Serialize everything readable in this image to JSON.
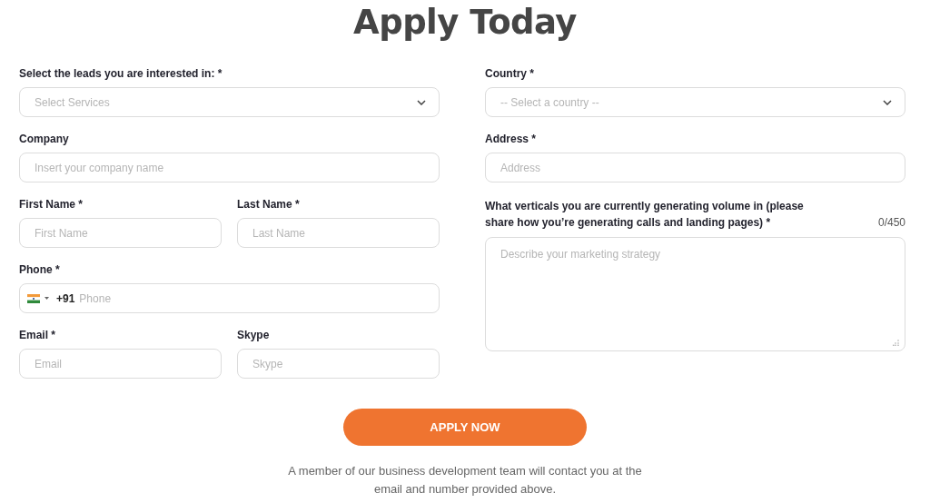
{
  "title": "Apply Today",
  "left_column": [
    {
      "fields": [
        {
          "kind": "select",
          "label": "Select the leads you are interested in: *",
          "placeholder": "Select Services"
        }
      ]
    },
    {
      "fields": [
        {
          "kind": "text",
          "label": "Company",
          "placeholder": "Insert your company name"
        }
      ]
    },
    {
      "fields": [
        {
          "kind": "text",
          "label": "First Name *",
          "placeholder": "First Name"
        },
        {
          "kind": "text",
          "label": "Last Name *",
          "placeholder": "Last Name"
        }
      ]
    },
    {
      "fields": [
        {
          "kind": "phone",
          "label": "Phone *",
          "dial_code": "+91",
          "placeholder": "Phone"
        }
      ]
    },
    {
      "fields": [
        {
          "kind": "text",
          "label": "Email *",
          "placeholder": "Email"
        },
        {
          "kind": "text",
          "label": "Skype",
          "placeholder": "Skype"
        }
      ]
    }
  ],
  "right_column": [
    {
      "fields": [
        {
          "kind": "select",
          "label": "Country *",
          "placeholder": "-- Select a country --"
        }
      ]
    },
    {
      "fields": [
        {
          "kind": "text",
          "label": "Address *",
          "placeholder": "Address"
        }
      ]
    },
    {
      "fields": [
        {
          "kind": "textarea",
          "label": "What verticals you are currently generating volume in (please share how you’re generating calls and landing pages) *",
          "counter": "0/450",
          "placeholder": "Describe your marketing strategy"
        }
      ]
    }
  ],
  "submit_button": "APPLY NOW",
  "note": "A member of our business development team will contact you at the email and number provided above."
}
